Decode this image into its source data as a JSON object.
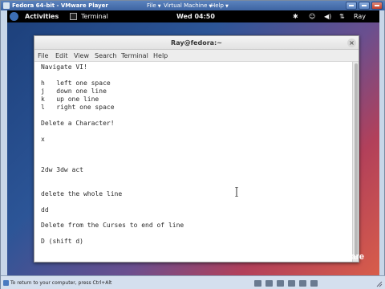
{
  "vm": {
    "title": "Fedora 64-bit - VMware Player",
    "menus": [
      {
        "label": "File"
      },
      {
        "label": "Virtual Machine"
      },
      {
        "label": "Help"
      }
    ],
    "status_message": "To return to your computer, press Ctrl+Alt",
    "brand": "vmware"
  },
  "topbar": {
    "activities": "Activities",
    "app_name": "Terminal",
    "clock": "Wed 04:50",
    "user": "Ray"
  },
  "terminal": {
    "title": "Ray@fedora:~",
    "close": "×",
    "menu": [
      "File",
      "Edit",
      "View",
      "Search",
      "Terminal",
      "Help"
    ],
    "lines": [
      "Navigate VI!",
      "",
      "h   left one space",
      "j   down one line",
      "k   up one line",
      "l   right one space",
      "",
      "Delete a Character!",
      "",
      "x",
      "",
      "",
      "",
      "2dw 3dw act",
      "",
      "",
      "delete the whole line",
      "",
      "dd",
      "",
      "Delete from the Curses to end of line",
      "",
      "D (shift d)"
    ]
  },
  "colors": {
    "terminal_bg": "#ffffff",
    "topbar_bg": "#000000",
    "vm_titlebar": "#3d64a2"
  }
}
